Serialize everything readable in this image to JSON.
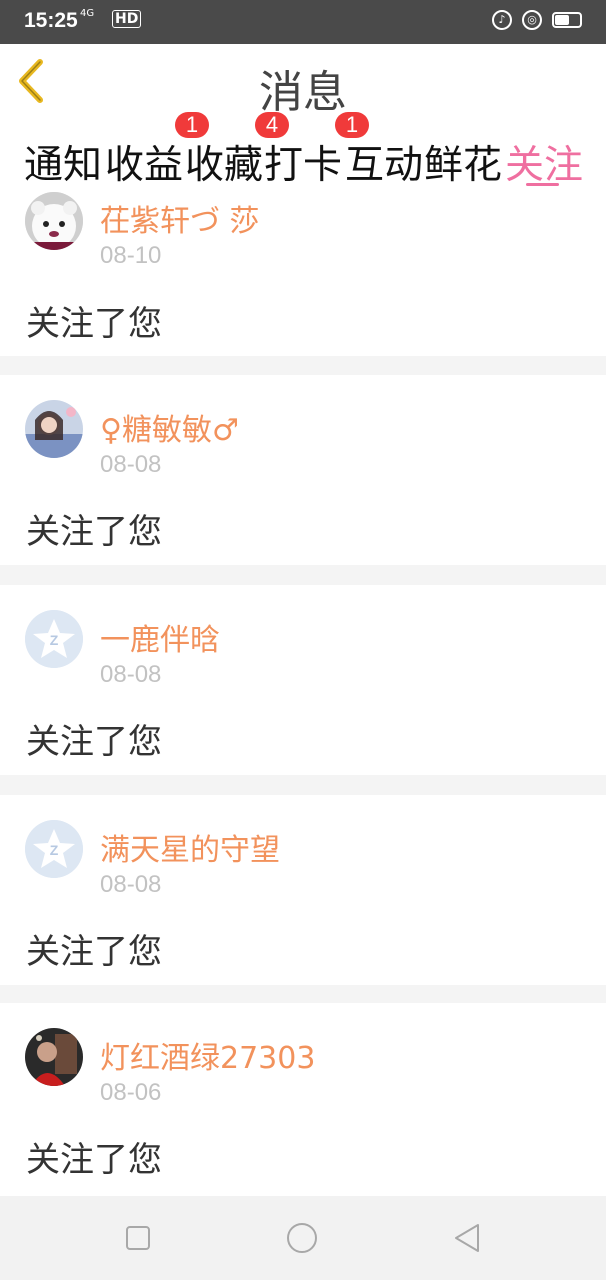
{
  "status_bar": {
    "time": "15:25",
    "network": "4G",
    "hd": "HD"
  },
  "header": {
    "title": "消息"
  },
  "tabs": [
    {
      "label": "通知"
    },
    {
      "label": "收益",
      "badge": "1"
    },
    {
      "label": "收藏",
      "badge": "4"
    },
    {
      "label": "打卡"
    },
    {
      "label": "互动",
      "badge": "1"
    },
    {
      "label": "鲜花"
    },
    {
      "label": "关注",
      "active": true
    }
  ],
  "colors": {
    "accent": "#ef6fa0",
    "username": "#f2925c",
    "badge": "#f03a3a"
  },
  "items": [
    {
      "name": "茌紫轩づ 莎",
      "date": "08-10",
      "text": "关注了您",
      "avatar_icon": "panda-avatar-icon"
    },
    {
      "name": "♀糖敏敏♂",
      "date": "08-08",
      "text": "关注了您",
      "avatar_icon": "photo-avatar-icon"
    },
    {
      "name": "一鹿伴晗",
      "date": "08-08",
      "text": "关注了您",
      "avatar_icon": "default-star-avatar-icon"
    },
    {
      "name": "满天星的守望",
      "date": "08-08",
      "text": "关注了您",
      "avatar_icon": "default-star-avatar-icon"
    },
    {
      "name": "灯红酒绿27303",
      "date": "08-06",
      "text": "关注了您",
      "avatar_icon": "photo-avatar-icon"
    }
  ],
  "nav": {
    "icons": [
      "recents-square-icon",
      "home-circle-icon",
      "back-triangle-icon"
    ]
  }
}
